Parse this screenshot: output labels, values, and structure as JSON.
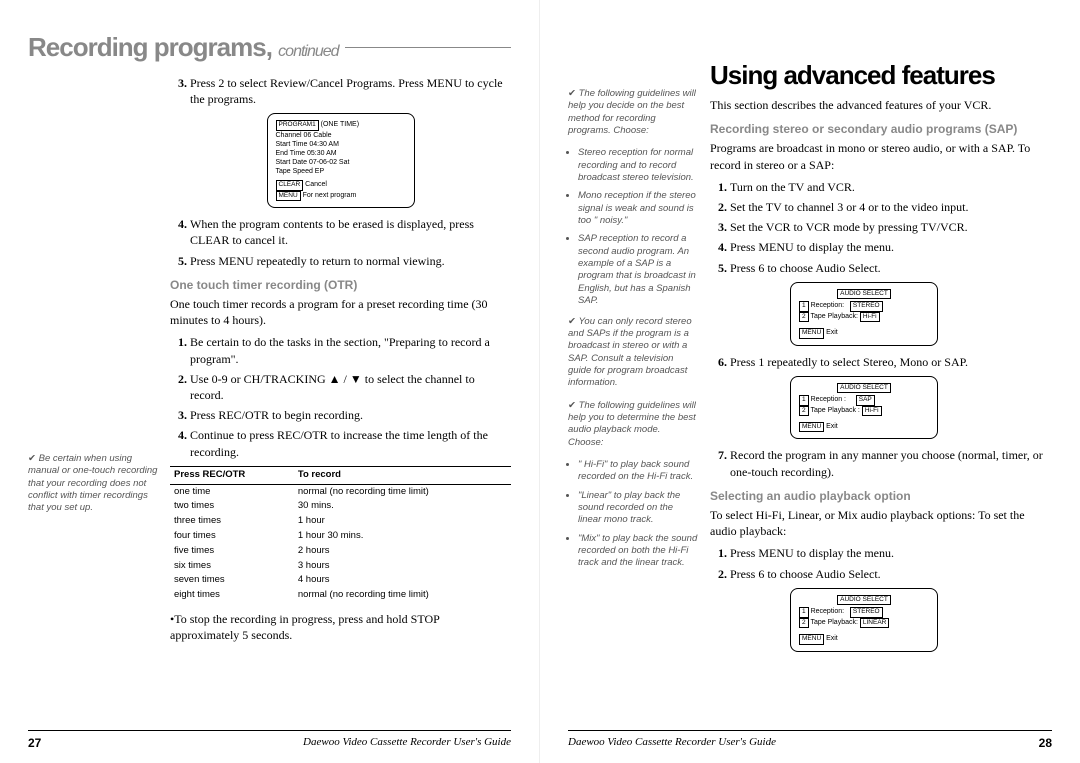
{
  "left": {
    "title": "Recording programs,",
    "titleCont": "continued",
    "steps_a": [
      {
        "n": "3",
        "t": "Press 2 to select Review/Cancel Programs. Press MENU to cycle the programs."
      },
      {
        "n": "4",
        "t": "When the program contents to be erased is displayed, press CLEAR to cancel it."
      },
      {
        "n": "5",
        "t": "Press MENU repeatedly to return to normal viewing."
      }
    ],
    "screen1": {
      "header": "PROGRAM1",
      "headerNote": "(ONE TIME)",
      "l1": "Channel   06  Cable",
      "l2": "Start Time 04:30 AM",
      "l3": "End Time  05:30 AM",
      "l4": "Start Date 07-06-02 Sat",
      "l5": "Tape Speed EP",
      "f1": "CLEAR",
      "f1t": " Cancel",
      "f2": "MENU",
      "f2t": " For next program"
    },
    "otr_h": "One touch timer recording (OTR)",
    "otr_intro": "One touch timer records a program for a preset recording time (30 minutes to 4 hours).",
    "otr_steps": [
      "Be certain to do the tasks in the section, \"Preparing to record a program\".",
      "Use 0-9 or CH/TRACKING ▲ / ▼ to select the channel to record.",
      "Press REC/OTR to begin recording.",
      "Continue to press REC/OTR to increase the time length of the recording."
    ],
    "side_tip": "Be certain when using manual or one-touch recording that your recording does not conflict with timer recordings that you set up.",
    "table": {
      "h1": "Press  REC/OTR",
      "h2": "To record",
      "rows": [
        [
          "one time",
          "normal (no recording  time limit)"
        ],
        [
          "two times",
          "30 mins."
        ],
        [
          "three times",
          "1 hour"
        ],
        [
          "four times",
          "1 hour 30 mins."
        ],
        [
          "five times",
          "2 hours"
        ],
        [
          "six times",
          "3 hours"
        ],
        [
          "seven times",
          "4 hours"
        ],
        [
          "eight times",
          "normal (no recording time limit)"
        ]
      ]
    },
    "stop_note": "•To stop the recording in progress, press and hold STOP approximately 5 seconds.",
    "footer": "Daewoo Video Cassette Recorder User's Guide",
    "pnum": "27"
  },
  "right": {
    "title": "Using advanced features",
    "intro": "This section describes the advanced features of your VCR.",
    "sap_h": "Recording stereo or secondary audio programs (SAP)",
    "sap_intro": "Programs are broadcast in mono or stereo audio, or with a SAP. To record in stereo or a SAP:",
    "sap_steps": [
      "Turn on the TV and VCR.",
      "Set the TV to channel 3 or 4 or to the video input.",
      "Set the VCR to VCR mode by pressing TV/VCR.",
      "Press MENU to display the menu.",
      "Press 6 to choose Audio Select."
    ],
    "sap_step6": "Press 1 repeatedly to select Stereo, Mono or SAP.",
    "sap_step7": "Record the program in any manner you choose (normal, timer, or one-touch recording).",
    "screenA": {
      "title": "AUDIO SELECT",
      "l1a": "1",
      "l1b": "Reception:",
      "l1c": "STEREO",
      "l2a": "2",
      "l2b": "Tape Playback:",
      "l2c": "Hi-Fi",
      "f": "MENU",
      "ft": " Exit"
    },
    "screenB": {
      "title": "AUDIO SELECT",
      "l1a": "1",
      "l1b": "Reception :",
      "l1c": "SAP",
      "l2a": "2",
      "l2b": "Tape Playback :",
      "l2c": "Hi-Fi",
      "f": "MENU",
      "ft": " Exit"
    },
    "screenC": {
      "title": "AUDIO SELECT",
      "l1a": "1",
      "l1b": "Reception:",
      "l1c": "STEREO",
      "l2a": "2",
      "l2b": "Tape Playback:",
      "l2c": "LINEAR",
      "f": "MENU",
      "ft": " Exit"
    },
    "sel_h": "Selecting an audio playback option",
    "sel_intro": "To select Hi-Fi, Linear, or Mix audio playback options: To set the audio playback:",
    "sel_steps": [
      "Press MENU to display the menu.",
      "Press 6 to choose  Audio Select."
    ],
    "side": {
      "g1": "The following guidelines will help you decide on the best method for recording programs. Choose:",
      "b1": "Stereo reception for normal recording and to record broadcast stereo television.",
      "b2": "Mono reception if the stereo signal is weak and sound is too \" noisy.\"",
      "b3": "SAP reception to record a second audio program. An example of a SAP is a program that is broadcast in English, but has a Spanish SAP.",
      "g2": "You can only record stereo and SAPs if the program is a broadcast in stereo or with a SAP. Consult a television guide for program broadcast information.",
      "g3": "The following guidelines will help you to determine the best audio playback mode. Choose:",
      "c1": "\" Hi-Fi\" to play back sound recorded on the Hi-Fi track.",
      "c2": "\"Linear\" to play back the sound recorded on the linear mono track.",
      "c3": "\"Mix\" to play back the sound recorded on both the Hi-Fi track and the linear track."
    },
    "footer": "Daewoo Video Cassette Recorder User's Guide",
    "pnum": "28"
  }
}
